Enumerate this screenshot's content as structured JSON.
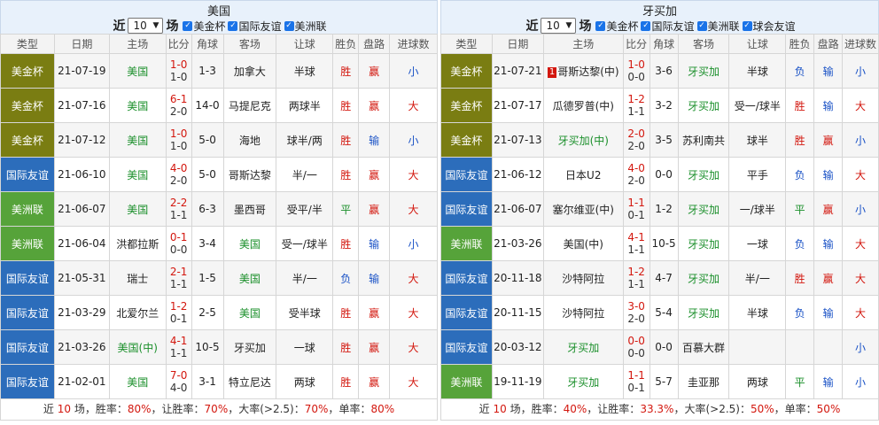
{
  "common": {
    "near": "近",
    "count": "10",
    "unit": "场",
    "headers": [
      "类型",
      "日期",
      "主场",
      "比分",
      "角球",
      "客场",
      "让球",
      "胜负",
      "盘路",
      "进球数"
    ],
    "foot_near": "近",
    "foot_unit": "场，胜率：",
    "foot_hwl": "让胜率：",
    "foot_big": "大率(>2.5)：",
    "foot_single": "单率：",
    "sep": "，"
  },
  "left": {
    "title": "美国",
    "filters": [
      "美金杯",
      "国际友谊",
      "美洲联"
    ],
    "stats": {
      "count": "10",
      "win": "80%",
      "handicap_win": "70%",
      "big": "70%",
      "single": "80%"
    },
    "rows": [
      {
        "type": "美金杯",
        "tc": "c1",
        "date": "21-07-19",
        "home": "美国",
        "hh": true,
        "s1": "1-0",
        "s2": "1-0",
        "corner": "1-3",
        "away": "加拿大",
        "ah": false,
        "line": "半球",
        "wl": "胜",
        "wlc": "win",
        "pan": "赢",
        "panc": "win",
        "ou": "小",
        "ouc": "small2"
      },
      {
        "type": "美金杯",
        "tc": "c1",
        "date": "21-07-16",
        "home": "美国",
        "hh": true,
        "s1": "6-1",
        "s2": "2-0",
        "corner": "14-0",
        "away": "马提尼克",
        "ah": false,
        "line": "两球半",
        "wl": "胜",
        "wlc": "win",
        "pan": "赢",
        "panc": "win",
        "ou": "大",
        "ouc": "big2"
      },
      {
        "type": "美金杯",
        "tc": "c1",
        "date": "21-07-12",
        "home": "美国",
        "hh": true,
        "s1": "1-0",
        "s2": "1-0",
        "corner": "5-0",
        "away": "海地",
        "ah": false,
        "line": "球半/两",
        "wl": "胜",
        "wlc": "win",
        "pan": "输",
        "panc": "lose",
        "ou": "小",
        "ouc": "small2"
      },
      {
        "type": "国际友谊",
        "tc": "c2",
        "date": "21-06-10",
        "home": "美国",
        "hh": true,
        "s1": "4-0",
        "s2": "2-0",
        "corner": "5-0",
        "away": "哥斯达黎",
        "ah": false,
        "line": "半/一",
        "wl": "胜",
        "wlc": "win",
        "pan": "赢",
        "panc": "win",
        "ou": "大",
        "ouc": "big2"
      },
      {
        "type": "美洲联",
        "tc": "c3",
        "date": "21-06-07",
        "home": "美国",
        "hh": true,
        "s1": "2-2",
        "s2": "1-1",
        "corner": "6-3",
        "away": "墨西哥",
        "ah": false,
        "line": "受平/半",
        "wl": "平",
        "wlc": "draw",
        "pan": "赢",
        "panc": "win",
        "ou": "大",
        "ouc": "big2"
      },
      {
        "type": "美洲联",
        "tc": "c3",
        "date": "21-06-04",
        "home": "洪都拉斯",
        "hh": false,
        "s1": "0-1",
        "s2": "0-0",
        "corner": "3-4",
        "away": "美国",
        "ah": true,
        "line": "受一/球半",
        "wl": "胜",
        "wlc": "win",
        "pan": "输",
        "panc": "lose",
        "ou": "小",
        "ouc": "small2"
      },
      {
        "type": "国际友谊",
        "tc": "c2",
        "date": "21-05-31",
        "home": "瑞士",
        "hh": false,
        "s1": "2-1",
        "s2": "1-1",
        "corner": "1-5",
        "away": "美国",
        "ah": true,
        "line": "半/一",
        "wl": "负",
        "wlc": "lose",
        "pan": "输",
        "panc": "lose",
        "ou": "大",
        "ouc": "big2"
      },
      {
        "type": "国际友谊",
        "tc": "c2",
        "date": "21-03-29",
        "home": "北爱尔兰",
        "hh": false,
        "s1": "1-2",
        "s2": "0-1",
        "corner": "2-5",
        "away": "美国",
        "ah": true,
        "line": "受半球",
        "wl": "胜",
        "wlc": "win",
        "pan": "赢",
        "panc": "win",
        "ou": "大",
        "ouc": "big2"
      },
      {
        "type": "国际友谊",
        "tc": "c2",
        "date": "21-03-26",
        "home": "美国(中)",
        "hh": true,
        "s1": "4-1",
        "s2": "1-1",
        "corner": "10-5",
        "away": "牙买加",
        "ah": false,
        "line": "一球",
        "wl": "胜",
        "wlc": "win",
        "pan": "赢",
        "panc": "win",
        "ou": "大",
        "ouc": "big2"
      },
      {
        "type": "国际友谊",
        "tc": "c2",
        "date": "21-02-01",
        "home": "美国",
        "hh": true,
        "s1": "7-0",
        "s2": "4-0",
        "corner": "3-1",
        "away": "特立尼达",
        "ah": false,
        "line": "两球",
        "wl": "胜",
        "wlc": "win",
        "pan": "赢",
        "panc": "win",
        "ou": "大",
        "ouc": "big2"
      }
    ]
  },
  "right": {
    "title": "牙买加",
    "filters": [
      "美金杯",
      "国际友谊",
      "美洲联",
      "球会友谊"
    ],
    "stats": {
      "count": "10",
      "win": "40%",
      "handicap_win": "33.3%",
      "big": "50%",
      "single": "50%"
    },
    "rows": [
      {
        "type": "美金杯",
        "tc": "c1",
        "date": "21-07-21",
        "badge": "1",
        "home": "哥斯达黎(中)",
        "hh": false,
        "s1": "1-0",
        "s2": "0-0",
        "corner": "3-6",
        "away": "牙买加",
        "ah": true,
        "line": "半球",
        "wl": "负",
        "wlc": "lose",
        "pan": "输",
        "panc": "lose",
        "ou": "小",
        "ouc": "small2"
      },
      {
        "type": "美金杯",
        "tc": "c1",
        "date": "21-07-17",
        "home": "瓜德罗普(中)",
        "hh": false,
        "s1": "1-2",
        "s2": "1-1",
        "corner": "3-2",
        "away": "牙买加",
        "ah": true,
        "line": "受一/球半",
        "wl": "胜",
        "wlc": "win",
        "pan": "输",
        "panc": "lose",
        "ou": "大",
        "ouc": "big2"
      },
      {
        "type": "美金杯",
        "tc": "c1",
        "date": "21-07-13",
        "home": "牙买加(中)",
        "hh": true,
        "s1": "2-0",
        "s2": "2-0",
        "corner": "3-5",
        "away": "苏利南共",
        "ah": false,
        "line": "球半",
        "wl": "胜",
        "wlc": "win",
        "pan": "赢",
        "panc": "win",
        "ou": "小",
        "ouc": "small2"
      },
      {
        "type": "国际友谊",
        "tc": "c2",
        "date": "21-06-12",
        "home": "日本U2",
        "hh": false,
        "s1": "4-0",
        "s2": "2-0",
        "corner": "0-0",
        "away": "牙买加",
        "ah": true,
        "line": "平手",
        "wl": "负",
        "wlc": "lose",
        "pan": "输",
        "panc": "lose",
        "ou": "大",
        "ouc": "big2"
      },
      {
        "type": "国际友谊",
        "tc": "c2",
        "date": "21-06-07",
        "home": "塞尔维亚(中)",
        "hh": false,
        "s1": "1-1",
        "s2": "0-1",
        "corner": "1-2",
        "away": "牙买加",
        "ah": true,
        "line": "一/球半",
        "wl": "平",
        "wlc": "draw",
        "pan": "赢",
        "panc": "win",
        "ou": "小",
        "ouc": "small2"
      },
      {
        "type": "美洲联",
        "tc": "c3",
        "date": "21-03-26",
        "home": "美国(中)",
        "hh": false,
        "s1": "4-1",
        "s2": "1-1",
        "corner": "10-5",
        "away": "牙买加",
        "ah": true,
        "line": "一球",
        "wl": "负",
        "wlc": "lose",
        "pan": "输",
        "panc": "lose",
        "ou": "大",
        "ouc": "big2"
      },
      {
        "type": "国际友谊",
        "tc": "c2",
        "date": "20-11-18",
        "home": "沙特阿拉",
        "hh": false,
        "s1": "1-2",
        "s2": "1-1",
        "corner": "4-7",
        "away": "牙买加",
        "ah": true,
        "line": "半/一",
        "wl": "胜",
        "wlc": "win",
        "pan": "赢",
        "panc": "win",
        "ou": "大",
        "ouc": "big2"
      },
      {
        "type": "国际友谊",
        "tc": "c2",
        "date": "20-11-15",
        "home": "沙特阿拉",
        "hh": false,
        "s1": "3-0",
        "s2": "2-0",
        "corner": "5-4",
        "away": "牙买加",
        "ah": true,
        "line": "半球",
        "wl": "负",
        "wlc": "lose",
        "pan": "输",
        "panc": "lose",
        "ou": "大",
        "ouc": "big2"
      },
      {
        "type": "国际友谊",
        "tc": "c2",
        "date": "20-03-12",
        "home": "牙买加",
        "hh": true,
        "s1": "0-0",
        "s2": "0-0",
        "corner": "0-0",
        "away": "百慕大群",
        "ah": false,
        "line": "",
        "wl": "",
        "wlc": "",
        "pan": "",
        "panc": "",
        "ou": "小",
        "ouc": "small2"
      },
      {
        "type": "美洲联",
        "tc": "c3",
        "date": "19-11-19",
        "home": "牙买加",
        "hh": true,
        "s1": "1-1",
        "s2": "0-1",
        "corner": "5-7",
        "away": "圭亚那",
        "ah": false,
        "line": "两球",
        "wl": "平",
        "wlc": "draw",
        "pan": "输",
        "panc": "lose",
        "ou": "小",
        "ouc": "small2"
      }
    ]
  }
}
